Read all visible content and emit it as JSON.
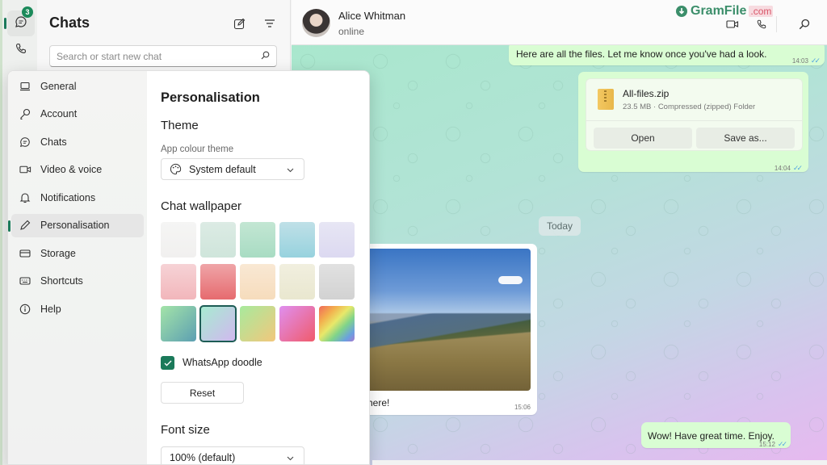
{
  "rail": {
    "chats_badge": "3",
    "items": [
      {
        "name": "chats",
        "icon": "chat-bubble-icon",
        "active": true
      },
      {
        "name": "calls",
        "icon": "phone-icon",
        "active": false
      }
    ]
  },
  "chatlist": {
    "title": "Chats",
    "new_chat_icon": "compose-icon",
    "filter_icon": "filter-icon",
    "search_placeholder": "Search or start new chat"
  },
  "header": {
    "contact_name": "Alice Whitman",
    "contact_status": "online",
    "watermark": {
      "name": "GramFile",
      "tld": ".com"
    },
    "actions": [
      "video-call-icon",
      "voice-call-icon",
      "search-icon"
    ]
  },
  "messages": [
    {
      "type": "text",
      "direction": "out",
      "text": "Here are all the files. Let me know once you've had a look.",
      "time": "14:03",
      "status": "read"
    },
    {
      "type": "file",
      "direction": "out",
      "file_name": "All-files.zip",
      "file_meta": "23.5 MB · Compressed (zipped) Folder",
      "buttons": [
        "Open",
        "Save as..."
      ],
      "time": "14:04",
      "status": "read"
    },
    {
      "type": "day-separator",
      "label": "Today"
    },
    {
      "type": "photo",
      "direction": "in",
      "caption": "here!",
      "time": "15:06"
    },
    {
      "type": "text",
      "direction": "out",
      "text": "Wow! Have great time. Enjoy.",
      "time": "15:12",
      "status": "read"
    }
  ],
  "settings": {
    "nav": [
      {
        "label": "General",
        "icon": "laptop-icon"
      },
      {
        "label": "Account",
        "icon": "key-icon"
      },
      {
        "label": "Chats",
        "icon": "chat-icon"
      },
      {
        "label": "Video & voice",
        "icon": "video-icon"
      },
      {
        "label": "Notifications",
        "icon": "bell-icon"
      },
      {
        "label": "Personalisation",
        "icon": "pencil-icon",
        "active": true
      },
      {
        "label": "Storage",
        "icon": "storage-icon"
      },
      {
        "label": "Shortcuts",
        "icon": "keyboard-icon"
      },
      {
        "label": "Help",
        "icon": "info-icon"
      }
    ],
    "title": "Personalisation",
    "theme_heading": "Theme",
    "app_colour_label": "App colour theme",
    "app_colour_value": "System default",
    "wallpaper_heading": "Chat wallpaper",
    "wallpapers": [
      {
        "from": "#f5f5f4",
        "to": "#f1f0ef"
      },
      {
        "from": "#dcebe4",
        "to": "#cfe5db"
      },
      {
        "from": "#c3e6d3",
        "to": "#a8dcc3"
      },
      {
        "from": "#bfe0e7",
        "to": "#97d2de"
      },
      {
        "from": "#e7e6f4",
        "to": "#dcd9f1"
      },
      {
        "from": "#f6d3d6",
        "to": "#f2b6bb"
      },
      {
        "from": "#efa5a8",
        "to": "#e66b6f"
      },
      {
        "from": "#f9e8d4",
        "to": "#f6dcbc"
      },
      {
        "from": "#f1efdf",
        "to": "#e9e7cf"
      },
      {
        "from": "#e1e1e1",
        "to": "#d2d2d2"
      },
      {
        "from": "#a4e4a8",
        "to": "#5c9fb2"
      },
      {
        "from": "#a6ecd0",
        "to": "#d2b7f0",
        "selected": true
      },
      {
        "from": "#a7ea9d",
        "to": "#f2c77c"
      },
      {
        "from": "#df8ff0",
        "to": "#f05b6b"
      },
      {
        "from": "#f06a5a",
        "to": "#a579d0",
        "rainbow": true
      }
    ],
    "doodle_label": "WhatsApp doodle",
    "doodle_checked": true,
    "reset_label": "Reset",
    "font_size_heading": "Font size",
    "font_size_value": "100% (default)"
  },
  "colors": {
    "accent": "#1b7a5a",
    "outgoing_bubble": "#d9fdd3",
    "read_ticks": "#53a6e0"
  }
}
